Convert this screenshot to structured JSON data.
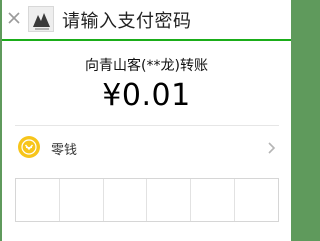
{
  "header": {
    "title": "请输入支付密码",
    "close_icon": "close-icon"
  },
  "payment": {
    "recipient": "向青山客(**龙)转账",
    "amount": "¥0.01"
  },
  "method": {
    "label": "零钱",
    "icon": "coin-icon",
    "arrow_icon": "chevron-right-icon"
  },
  "pin": {
    "cells": 6
  },
  "colors": {
    "accent": "#1aad19",
    "coin": "#f7c51b",
    "backdrop": "#5f9a5c"
  }
}
